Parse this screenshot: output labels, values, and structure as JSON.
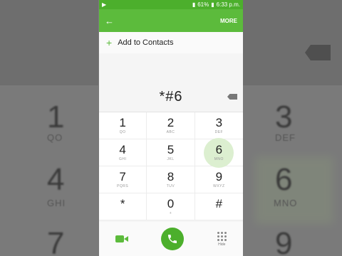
{
  "status": {
    "time": "6:33 p.m.",
    "battery": "61%"
  },
  "appbar": {
    "back_icon": "arrow-left-icon",
    "more_label": "MORE"
  },
  "contacts": {
    "add_label": "Add to Contacts",
    "plus_icon": "plus-icon"
  },
  "dialer": {
    "number": "*#6"
  },
  "keys": [
    {
      "d": "1",
      "s": "QO"
    },
    {
      "d": "2",
      "s": "ABC"
    },
    {
      "d": "3",
      "s": "DEF"
    },
    {
      "d": "4",
      "s": "GHI"
    },
    {
      "d": "5",
      "s": "JKL"
    },
    {
      "d": "6",
      "s": "MNO"
    },
    {
      "d": "7",
      "s": "PQRS"
    },
    {
      "d": "8",
      "s": "TUV"
    },
    {
      "d": "9",
      "s": "WXYZ"
    },
    {
      "d": "*",
      "s": ""
    },
    {
      "d": "0",
      "s": "+"
    },
    {
      "d": "#",
      "s": ""
    }
  ],
  "bottom": {
    "hide_label": "Hide"
  },
  "background": {
    "digits": [
      "1",
      "3",
      "4",
      "6",
      "7",
      "9"
    ],
    "subs": [
      "QO",
      "DEF",
      "GHI",
      "MNO"
    ]
  },
  "colors": {
    "accent": "#5cbb3c",
    "status_bar": "#4caf2c"
  }
}
